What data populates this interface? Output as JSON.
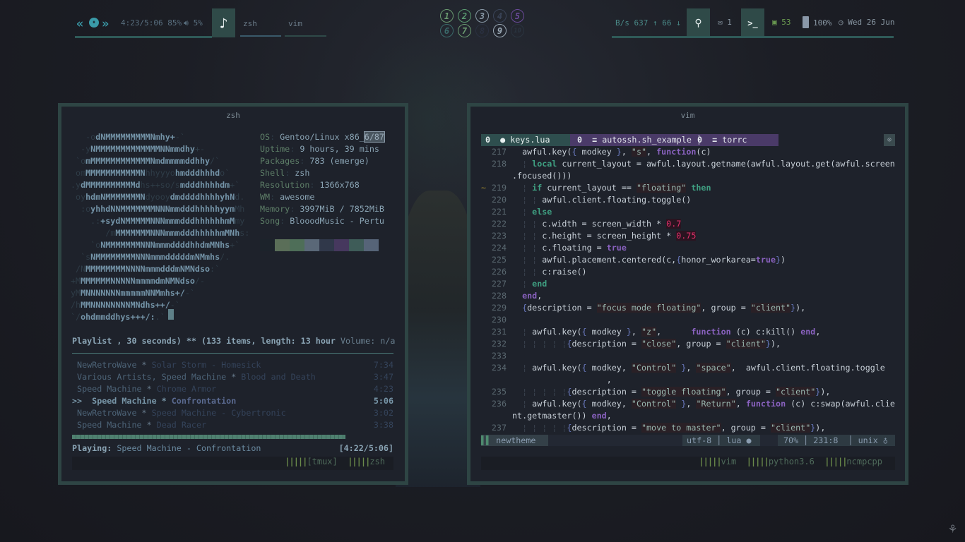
{
  "topbar": {
    "music": {
      "time": "4:23/5:06",
      "progress_pct": "85%",
      "volume": "5%",
      "prev_icon": "«",
      "pause_icon": "⏸",
      "next_icon": "»"
    },
    "tasks": [
      {
        "label": "zsh"
      },
      {
        "label": "vim"
      }
    ],
    "workspaces": [
      {
        "n": "1",
        "color": "#6a9a70"
      },
      {
        "n": "2",
        "color": "#5a9a70"
      },
      {
        "n": "3",
        "color": "#8a9aa8"
      },
      {
        "n": "4",
        "color": "#3a4458"
      },
      {
        "n": "5",
        "color": "#6a4a9a"
      },
      {
        "n": "6",
        "color": "#3a6a6a"
      },
      {
        "n": "7",
        "color": "#6a9a70"
      },
      {
        "n": "8",
        "color": "#2a3040"
      },
      {
        "n": "9",
        "color": "#9aa8b4"
      },
      {
        "n": "10",
        "color": "#2a3440"
      }
    ],
    "net": {
      "unit": "B/s",
      "up": "637",
      "down": "66"
    },
    "mail": "1",
    "cpu": "53",
    "battery": "100%",
    "date": "Wed 26 Jun"
  },
  "zsh": {
    "title": "zsh",
    "ascii": [
      [
        [
          "   -o",
          "d"
        ],
        [
          "dNMMMMMMMMMNmhy+",
          "b"
        ],
        [
          "-`",
          "d"
        ]
      ],
      [
        [
          "  -y",
          "d"
        ],
        [
          "NMMMMMMMMMMMMMNNmmdhy",
          "b"
        ],
        [
          "+-",
          "d"
        ]
      ],
      [
        [
          " `o",
          "d"
        ],
        [
          "mMMMMMMMMMMMMNmdmmmmddhhy",
          "b"
        ],
        [
          "/`",
          "d"
        ]
      ],
      [
        [
          " om",
          "d"
        ],
        [
          "MMMMMMMMMMMN",
          "b"
        ],
        [
          "hhyyyo",
          "d"
        ],
        [
          "hmdddhhhd",
          "b"
        ],
        [
          "o`",
          "d"
        ]
      ],
      [
        [
          ".y",
          "d"
        ],
        [
          "dMMMMMMMMMMd",
          "b"
        ],
        [
          "hs++so/s",
          "d"
        ],
        [
          "mdddhhhhdm",
          "b"
        ],
        [
          "+`",
          "d"
        ]
      ],
      [
        [
          " oy",
          "d"
        ],
        [
          "hdmNMMMMMMMN",
          "b"
        ],
        [
          "dyooy",
          "d"
        ],
        [
          "dmddddhhhhyhN",
          "b"
        ],
        [
          "d.",
          "d"
        ]
      ],
      [
        [
          "  :o",
          "d"
        ],
        [
          "yhhdNNMMMMMMMNNNmmdddhhhhhyym",
          "b"
        ],
        [
          "Mh",
          "d"
        ]
      ],
      [
        [
          "    .:",
          "d"
        ],
        [
          "+sydNMMMMMNNNmmmdddhhhhhhmM",
          "b"
        ],
        [
          "my",
          "d"
        ]
      ],
      [
        [
          "       /m",
          "d"
        ],
        [
          "MMMMMMMNNNmmmdddhhhhhmMNh",
          "b"
        ],
        [
          "s:",
          "d"
        ]
      ],
      [
        [
          "    `o",
          "d"
        ],
        [
          "NMMMMMMMNNNmmmddddhhdmMNhs",
          "b"
        ],
        [
          "+`",
          "d"
        ]
      ],
      [
        [
          "  `s",
          "d"
        ],
        [
          "NMMMMMMMMNNNmmmdddddmNMmhs",
          "b"
        ],
        [
          "/.",
          "d"
        ]
      ],
      [
        [
          " /N",
          "d"
        ],
        [
          "MMMMMMMMNNNNmmmdddmNMNdso",
          "b"
        ],
        [
          ":`",
          "d"
        ]
      ],
      [
        [
          "+M",
          "d"
        ],
        [
          "MMMMMMNNNNNmmmmdmNMNdso",
          "b"
        ],
        [
          "/-",
          "d"
        ]
      ],
      [
        [
          "yM",
          "d"
        ],
        [
          "MNNNNNNNmmmmmNNMmhs+/",
          "b"
        ],
        [
          "-`",
          "d"
        ]
      ],
      [
        [
          "/h",
          "d"
        ],
        [
          "MMNNNNNNNNMNdhs++/",
          "b"
        ],
        [
          "-`",
          "d"
        ]
      ],
      [
        [
          "`/",
          "d"
        ],
        [
          "ohdmmddhys+++/:",
          "b"
        ],
        [
          ".`",
          "d"
        ]
      ]
    ],
    "info": [
      {
        "label": "OS",
        "value": "Gentoo/Linux x86_",
        "extra": "6/87"
      },
      {
        "label": "Uptime",
        "value": "9 hours, 39 mins"
      },
      {
        "label": "Packages",
        "value": "783 (emerge)"
      },
      {
        "label": "Shell",
        "value": "zsh"
      },
      {
        "label": "Resolution",
        "value": "1366x768"
      },
      {
        "label": "WM",
        "value": "awesome"
      },
      {
        "label": "Memory",
        "value": "3997MiB / 7852MiB"
      },
      {
        "label": "Song",
        "value": "BlooodMusic - Pertu"
      }
    ],
    "palette": [
      "#1c232b",
      "#5a6e58",
      "#4e6e58",
      "#5a6878",
      "#30384a",
      "#46385e",
      "#3e5c58",
      "#566478"
    ],
    "playlist_header": "Playlist , 30 seconds) ** (133 items, length: 13 hour ",
    "volume": "Volume: n/a",
    "playlist": [
      {
        "artist": "NewRetroWave",
        "title": "Solar Storm - Homesick",
        "time": "7:34",
        "current": false
      },
      {
        "artist": "Various Artists, Speed Machine",
        "title": "Blood and Death",
        "time": "3:47",
        "current": false
      },
      {
        "artist": "Speed Machine",
        "title": "Chrome Armor",
        "time": "4:23",
        "current": false
      },
      {
        "artist": "Speed Machine",
        "title": "Confrontation",
        "time": "5:06",
        "current": true
      },
      {
        "artist": "NewRetroWave",
        "title": "Speed Machine - Cybertronic",
        "time": "3:02",
        "current": false
      },
      {
        "artist": "Speed Machine",
        "title": "Dead Racer",
        "time": "3:38",
        "current": false
      }
    ],
    "progress_fraction": 0.85,
    "playing_label": "Playing:",
    "playing": "Speed Machine - Confrontation",
    "playing_time": "[4:22/5:06]",
    "tmux_windows": [
      {
        "bars": "|||||",
        "label": "[tmux]"
      },
      {
        "bars": "|||||",
        "label": "zsh"
      }
    ]
  },
  "vim": {
    "title": "vim",
    "tabs": [
      {
        "n": "0",
        "name": "keys.lua"
      },
      {
        "n": "0",
        "name": "autossh.sh_example"
      },
      {
        "n": "0",
        "name": "torrc"
      }
    ],
    "lines": [
      {
        "n": "217",
        "t": [
          [
            "  awful.key(",
            ""
          ],
          [
            "{",
            "b"
          ],
          [
            " modkey ",
            ""
          ],
          [
            "}",
            "b"
          ],
          [
            ", ",
            ""
          ],
          [
            "\"s\"",
            "s"
          ],
          [
            ", ",
            ""
          ],
          [
            "function",
            "p"
          ],
          [
            "(c)",
            ""
          ]
        ]
      },
      {
        "n": "218",
        "t": [
          [
            "  ¦ ",
            "g"
          ],
          [
            "local",
            "k"
          ],
          [
            " current_layout = awful.layout.getname(awful.layout.get(awful.screen",
            ""
          ]
        ]
      },
      {
        "n": "",
        "t": [
          [
            ".focused()))",
            ""
          ]
        ]
      },
      {
        "n": "219",
        "m": "~",
        "t": [
          [
            "  ¦ ",
            "g"
          ],
          [
            "if",
            "k"
          ],
          [
            " current_layout == ",
            ""
          ],
          [
            "\"floating\"",
            "s"
          ],
          [
            " ",
            ""
          ],
          [
            "then",
            "k"
          ]
        ]
      },
      {
        "n": "220",
        "t": [
          [
            "  ¦ ¦ ",
            "g"
          ],
          [
            "awful.client.floating.toggle()",
            ""
          ]
        ]
      },
      {
        "n": "221",
        "t": [
          [
            "  ¦ ",
            "g"
          ],
          [
            "else",
            "k"
          ]
        ]
      },
      {
        "n": "222",
        "t": [
          [
            "  ¦ ¦ ",
            "g"
          ],
          [
            "c.width = screen_width * ",
            ""
          ],
          [
            "0.7",
            "n"
          ]
        ]
      },
      {
        "n": "223",
        "t": [
          [
            "  ¦ ¦ ",
            "g"
          ],
          [
            "c.height = screen_height * ",
            ""
          ],
          [
            "0.75",
            "n"
          ]
        ]
      },
      {
        "n": "224",
        "t": [
          [
            "  ¦ ¦ ",
            "g"
          ],
          [
            "c.floating = ",
            ""
          ],
          [
            "true",
            "p"
          ]
        ]
      },
      {
        "n": "225",
        "t": [
          [
            "  ¦ ¦ ",
            "g"
          ],
          [
            "awful.placement.centered(c,",
            ""
          ],
          [
            "{",
            "b"
          ],
          [
            "honor_workarea=",
            ""
          ],
          [
            "true",
            "p"
          ],
          [
            "}",
            "b"
          ],
          [
            ")",
            ""
          ]
        ]
      },
      {
        "n": "226",
        "t": [
          [
            "  ¦ ¦ ",
            "g"
          ],
          [
            "c:raise()",
            ""
          ]
        ]
      },
      {
        "n": "227",
        "t": [
          [
            "  ¦ ",
            "g"
          ],
          [
            "end",
            "k"
          ]
        ]
      },
      {
        "n": "228",
        "t": [
          [
            "  ",
            ""
          ],
          [
            "end",
            "p"
          ],
          [
            ",",
            ""
          ]
        ]
      },
      {
        "n": "229",
        "t": [
          [
            "  ",
            ""
          ],
          [
            "{",
            "b"
          ],
          [
            "description = ",
            ""
          ],
          [
            "\"focus mode floating\"",
            "s"
          ],
          [
            ", group = ",
            ""
          ],
          [
            "\"client\"",
            "s"
          ],
          [
            "}",
            "b"
          ],
          [
            "),",
            ""
          ]
        ]
      },
      {
        "n": "230",
        "t": []
      },
      {
        "n": "231",
        "t": [
          [
            "  ¦ ",
            "g"
          ],
          [
            "awful.key(",
            ""
          ],
          [
            "{",
            "b"
          ],
          [
            " modkey ",
            ""
          ],
          [
            "}",
            "b"
          ],
          [
            ", ",
            ""
          ],
          [
            "\"z\"",
            "s"
          ],
          [
            ",      ",
            ""
          ],
          [
            "function",
            "p"
          ],
          [
            " (c) c:kill() ",
            ""
          ],
          [
            "end",
            "p"
          ],
          [
            ",",
            ""
          ]
        ]
      },
      {
        "n": "232",
        "t": [
          [
            "  ¦ ¦ ¦ ¦ ¦",
            "g"
          ],
          [
            "{",
            "b"
          ],
          [
            "description = ",
            ""
          ],
          [
            "\"close\"",
            "s"
          ],
          [
            ", group = ",
            ""
          ],
          [
            "\"client\"",
            "s"
          ],
          [
            "}",
            "b"
          ],
          [
            "),",
            ""
          ]
        ]
      },
      {
        "n": "233",
        "t": []
      },
      {
        "n": "234",
        "t": [
          [
            "  ¦ ",
            "g"
          ],
          [
            "awful.key(",
            ""
          ],
          [
            "{",
            "b"
          ],
          [
            " modkey, ",
            ""
          ],
          [
            "\"Control\"",
            "s"
          ],
          [
            " ",
            ""
          ],
          [
            "}",
            "b"
          ],
          [
            ", ",
            ""
          ],
          [
            "\"space\"",
            "s"
          ],
          [
            ",  awful.client.floating.toggle",
            ""
          ]
        ]
      },
      {
        "n": "",
        "t": [
          [
            "                   ,",
            ""
          ]
        ]
      },
      {
        "n": "235",
        "t": [
          [
            "  ¦ ¦ ¦ ¦ ¦",
            "g"
          ],
          [
            "{",
            "b"
          ],
          [
            "description = ",
            ""
          ],
          [
            "\"toggle floating\"",
            "s"
          ],
          [
            ", group = ",
            ""
          ],
          [
            "\"client\"",
            "s"
          ],
          [
            "}",
            "b"
          ],
          [
            "),",
            ""
          ]
        ]
      },
      {
        "n": "236",
        "t": [
          [
            "  ¦ ",
            "g"
          ],
          [
            "awful.key(",
            ""
          ],
          [
            "{",
            "b"
          ],
          [
            " modkey, ",
            ""
          ],
          [
            "\"Control\"",
            "s"
          ],
          [
            " ",
            ""
          ],
          [
            "}",
            "b"
          ],
          [
            ", ",
            ""
          ],
          [
            "\"Return\"",
            "s"
          ],
          [
            ", ",
            ""
          ],
          [
            "function",
            "p"
          ],
          [
            " (c) c:swap(awful.clie",
            ""
          ]
        ]
      },
      {
        "n": "",
        "t": [
          [
            "nt.getmaster()) ",
            ""
          ],
          [
            "end",
            "p"
          ],
          [
            ",",
            ""
          ]
        ]
      },
      {
        "n": "237",
        "t": [
          [
            "  ¦ ¦ ¦ ¦ ¦",
            "g"
          ],
          [
            "{",
            "b"
          ],
          [
            "description = ",
            ""
          ],
          [
            "\"move to master\"",
            "s"
          ],
          [
            ", group = ",
            ""
          ],
          [
            "\"client\"",
            "s"
          ],
          [
            "}",
            "b"
          ],
          [
            "),",
            ""
          ]
        ]
      }
    ],
    "status": {
      "branch": "newtheme",
      "encoding": "utf-8",
      "filetype": "lua",
      "percent": "70%",
      "position": "231:8",
      "format": "unix"
    },
    "tmux_windows": [
      {
        "bars": "|||||",
        "label": "vim"
      },
      {
        "bars": "|||||",
        "label": "python3.6"
      },
      {
        "bars": "|||||",
        "label": "ncmpcpp"
      }
    ]
  }
}
